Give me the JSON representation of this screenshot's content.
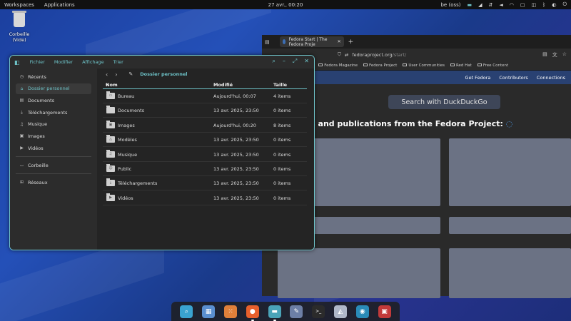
{
  "topbar": {
    "workspaces": "Workspaces",
    "applications": "Applications",
    "clock": "27 avr., 00:20",
    "keyboard": "be (oss)"
  },
  "desktop": {
    "trash_label": "Corbeille (Vide)"
  },
  "browser": {
    "tab_title": "Fedora Start | The Fedora Proje",
    "url_host": "fedoraproject.org",
    "url_path": "/start/",
    "bookmarks": [
      "ocs",
      "Fedora Magazine",
      "Fedora Project",
      "User Communities",
      "Red Hat",
      "Free Content"
    ],
    "site_nav": [
      "Get Fedora",
      "Contributors",
      "Connections"
    ],
    "search_placeholder": "Search with DuckDuckGo",
    "news_heading": "vs and publications from the Fedora Project:"
  },
  "files": {
    "menu": [
      "Fichier",
      "Modifier",
      "Affichage",
      "Trier"
    ],
    "sidebar": [
      {
        "label": "Récents",
        "icon": "clock-icon",
        "glyph": "◷"
      },
      {
        "label": "Dossier personnel",
        "icon": "home-icon",
        "glyph": "⌂",
        "active": true
      },
      {
        "label": "Documents",
        "icon": "document-icon",
        "glyph": "▤"
      },
      {
        "label": "Téléchargements",
        "icon": "download-icon",
        "glyph": "⤓"
      },
      {
        "label": "Musique",
        "icon": "music-icon",
        "glyph": "♫"
      },
      {
        "label": "Images",
        "icon": "image-icon",
        "glyph": "▣"
      },
      {
        "label": "Vidéos",
        "icon": "video-icon",
        "glyph": "▶"
      }
    ],
    "sidebar_extra": [
      {
        "label": "Corbeille",
        "icon": "trash-icon",
        "glyph": "⌴"
      },
      {
        "label": "Réseaux",
        "icon": "network-icon",
        "glyph": "⊞"
      }
    ],
    "path_title": "Dossier personnel",
    "columns": {
      "name": "Nom",
      "modified": "Modifié",
      "size": "Taille"
    },
    "rows": [
      {
        "name": "Bureau",
        "modified": "Aujourd'hui, 00:07",
        "size": "4 items",
        "glyph": "▭"
      },
      {
        "name": "Documents",
        "modified": "13 avr. 2025, 23:50",
        "size": "0 items",
        "glyph": ""
      },
      {
        "name": "Images",
        "modified": "Aujourd'hui, 00:20",
        "size": "8 items",
        "glyph": "▣"
      },
      {
        "name": "Modèles",
        "modified": "13 avr. 2025, 23:50",
        "size": "0 items",
        "glyph": "◬"
      },
      {
        "name": "Musique",
        "modified": "13 avr. 2025, 23:50",
        "size": "0 items",
        "glyph": "♫"
      },
      {
        "name": "Public",
        "modified": "13 avr. 2025, 23:50",
        "size": "0 items",
        "glyph": "☺"
      },
      {
        "name": "Téléchargements",
        "modified": "13 avr. 2025, 23:50",
        "size": "0 items",
        "glyph": "⤓"
      },
      {
        "name": "Vidéos",
        "modified": "13 avr. 2025, 23:50",
        "size": "0 items",
        "glyph": "▶"
      }
    ]
  },
  "dock": [
    {
      "name": "search-app-icon",
      "glyph": "⌕",
      "color": "#3aa3d0"
    },
    {
      "name": "workspace-app-icon",
      "glyph": "▦",
      "color": "#5a8fcf"
    },
    {
      "name": "app-grid-icon",
      "glyph": "⁙",
      "color": "#e0803a"
    },
    {
      "name": "firefox-icon",
      "glyph": "●",
      "color": "#e8602c",
      "running": true
    },
    {
      "name": "files-icon",
      "glyph": "▬",
      "color": "#4aa3b8",
      "running": true
    },
    {
      "name": "text-editor-icon",
      "glyph": "✎",
      "color": "#6d7fa6"
    },
    {
      "name": "terminal-icon",
      "glyph": ">_",
      "color": "#2b2b2b"
    },
    {
      "name": "software-icon",
      "glyph": "◭",
      "color": "#b0b8c8"
    },
    {
      "name": "settings-app-icon",
      "glyph": "◉",
      "color": "#2a8bb8"
    },
    {
      "name": "screenshot-icon",
      "glyph": "▣",
      "color": "#c23a3a"
    }
  ]
}
